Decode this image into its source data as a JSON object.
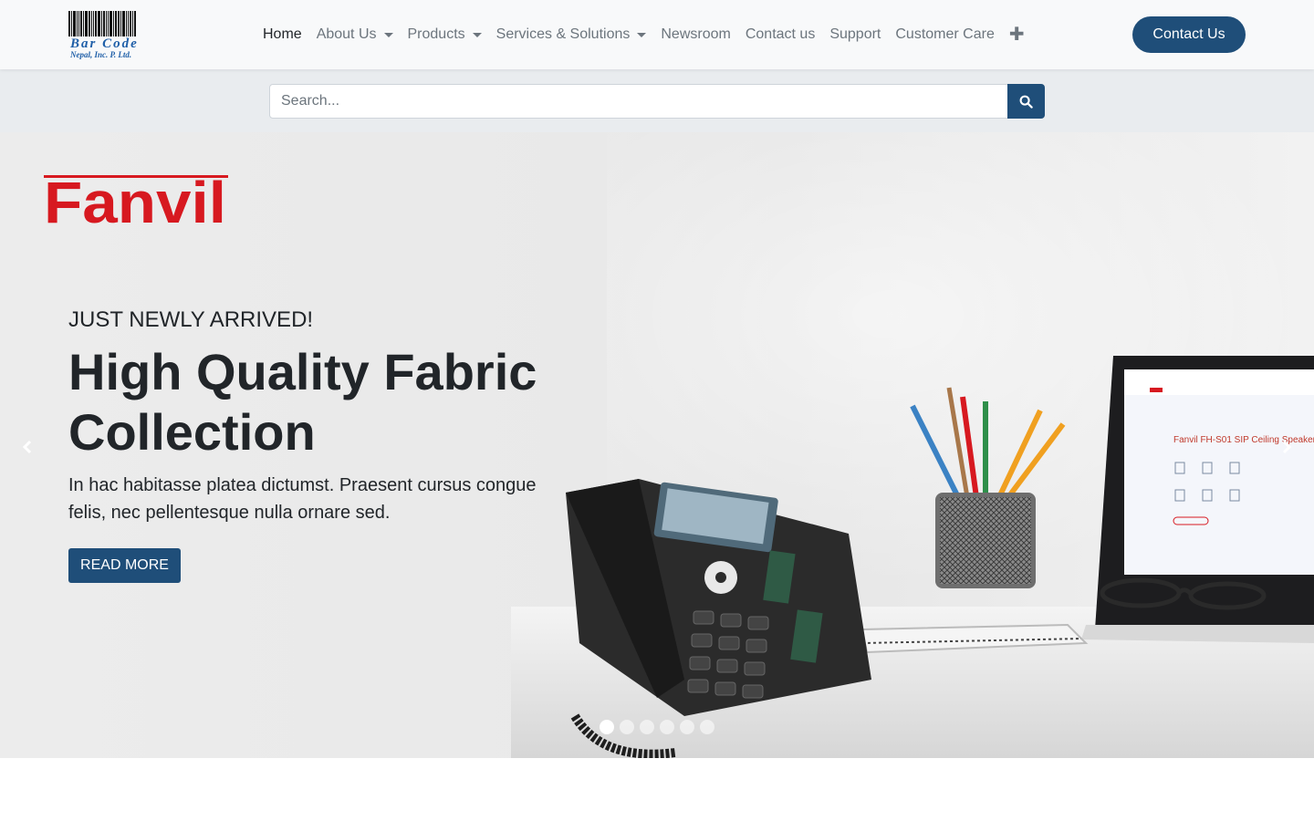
{
  "logo": {
    "brand": "Bar Code",
    "sub": "Nepal, Inc. P. Ltd."
  },
  "nav": {
    "items": [
      {
        "label": "Home",
        "active": true,
        "dropdown": false
      },
      {
        "label": "About Us",
        "active": false,
        "dropdown": true
      },
      {
        "label": "Products",
        "active": false,
        "dropdown": true
      },
      {
        "label": "Services & Solutions",
        "active": false,
        "dropdown": true
      },
      {
        "label": "Newsroom",
        "active": false,
        "dropdown": false
      },
      {
        "label": "Contact us",
        "active": false,
        "dropdown": false
      },
      {
        "label": "Support",
        "active": false,
        "dropdown": false
      },
      {
        "label": "Customer Care",
        "active": false,
        "dropdown": false
      }
    ],
    "more_icon": "plus-icon",
    "cta_label": "Contact Us"
  },
  "search": {
    "placeholder": "Search...",
    "value": "",
    "button_icon": "search-icon"
  },
  "hero": {
    "brand_logo_text": "Fanvil",
    "eyebrow": "JUST NEWLY ARRIVED!",
    "headline": "High Quality Fabric Collection",
    "lead": "In hac habitasse platea dictumst. Praesent cursus congue felis, nec pellentesque nulla ornare sed.",
    "button_label": "READ MORE",
    "laptop_screen_title": "Fanvil FH-S01 SIP Ceiling Speaker",
    "slides_total": 6,
    "active_slide": 1
  },
  "colors": {
    "primary": "#1f4e79",
    "header_bg": "#f8f9fa",
    "search_band_bg": "#e9ecef",
    "fanvil_red": "#d71920"
  }
}
